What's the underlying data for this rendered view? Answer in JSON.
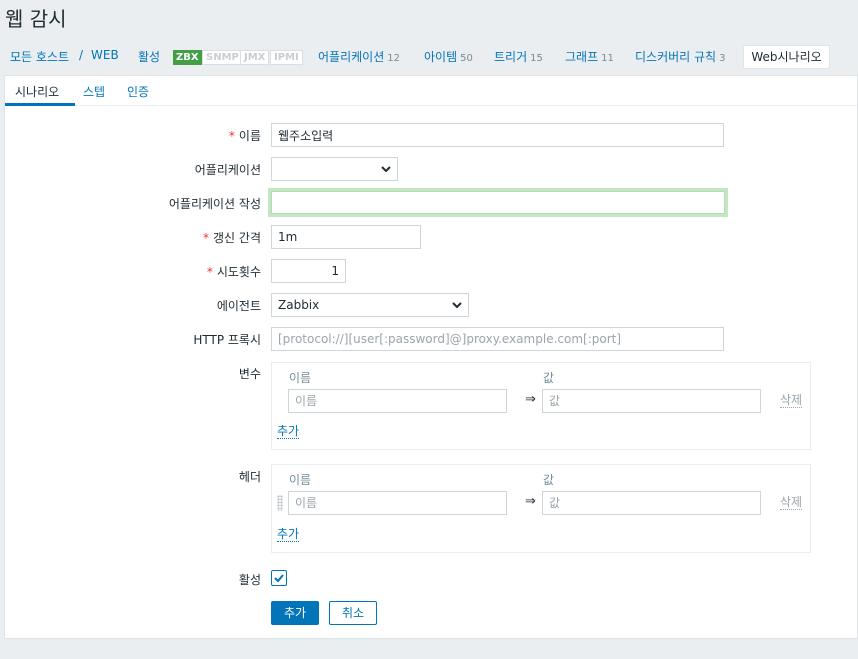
{
  "page": {
    "title": "웹 감시"
  },
  "nav": {
    "all_hosts": "모든 호스트",
    "separator": "/",
    "host": "WEB",
    "status": "활성",
    "badges": {
      "zbx": "ZBX",
      "snmp": "SNMP",
      "jmx": "JMX",
      "ipmi": "IPMI"
    },
    "applications": {
      "label": "어플리케이션",
      "count": "12"
    },
    "items": {
      "label": "아이템",
      "count": "50"
    },
    "triggers": {
      "label": "트리거",
      "count": "15"
    },
    "graphs": {
      "label": "그래프",
      "count": "11"
    },
    "discovery": {
      "label": "디스커버리 규칙",
      "count": "3"
    },
    "web_scenarios": "Web시나리오"
  },
  "tabs": {
    "scenario": "시나리오",
    "steps": "스텝",
    "auth": "인증"
  },
  "form": {
    "name": {
      "label": "이름",
      "value": "웹주소입력"
    },
    "application": {
      "label": "어플리케이션",
      "value": ""
    },
    "new_application": {
      "label": "어플리케이션 작성",
      "value": ""
    },
    "update_interval": {
      "label": "갱신 간격",
      "value": "1m"
    },
    "attempts": {
      "label": "시도횟수",
      "value": "1"
    },
    "agent": {
      "label": "에이전트",
      "value": "Zabbix"
    },
    "http_proxy": {
      "label": "HTTP 프록시",
      "placeholder": "[protocol://][user[:password]@]proxy.example.com[:port]"
    },
    "variables": {
      "label": "변수",
      "col_name": "이름",
      "col_value": "값",
      "name_placeholder": "이름",
      "value_placeholder": "값",
      "arrow": "⇒",
      "remove": "삭제",
      "add": "추가"
    },
    "headers": {
      "label": "헤더",
      "col_name": "이름",
      "col_value": "값",
      "name_placeholder": "이름",
      "value_placeholder": "값",
      "arrow": "⇒",
      "remove": "삭제",
      "add": "추가"
    },
    "enabled": {
      "label": "활성",
      "checked": true
    },
    "buttons": {
      "add": "추가",
      "cancel": "취소"
    }
  },
  "colors": {
    "accent": "#0275b8",
    "active": "#429e47",
    "required": "#e33734"
  }
}
